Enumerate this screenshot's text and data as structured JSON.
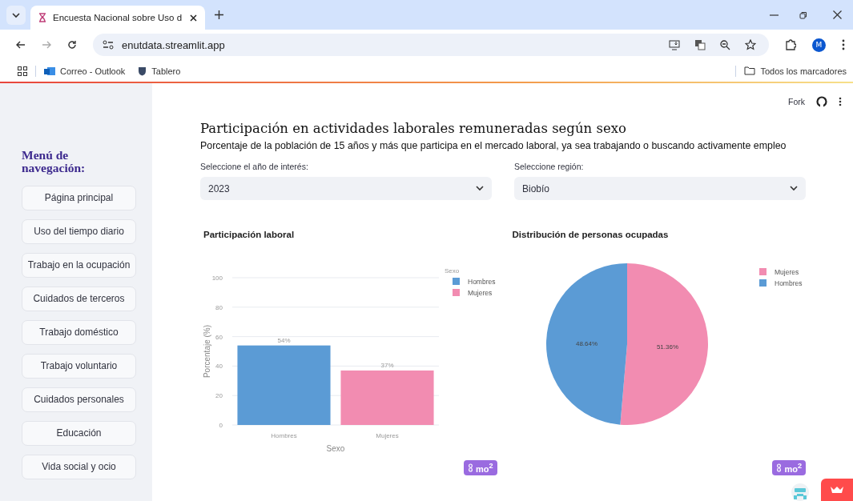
{
  "browser": {
    "tab_title": "Encuesta Nacional sobre Uso d",
    "url": "enutdata.streamlit.app",
    "avatar": "M",
    "bookmarks": [
      {
        "label": "Correo - Outlook",
        "kind": "mail"
      },
      {
        "label": "Tablero",
        "kind": "shield"
      }
    ],
    "all_bookmarks": "Todos los marcadores"
  },
  "toolbar": {
    "fork": "Fork"
  },
  "sidebar": {
    "title": "Menú de navegación:",
    "items": [
      {
        "label": "Página principal"
      },
      {
        "label": "Uso del tiempo diario"
      },
      {
        "label": "Trabajo en la ocupación"
      },
      {
        "label": "Cuidados de terceros"
      },
      {
        "label": "Trabajo doméstico"
      },
      {
        "label": "Trabajo voluntario"
      },
      {
        "label": "Cuidados personales"
      },
      {
        "label": "Educación"
      },
      {
        "label": "Vida social y ocio"
      }
    ]
  },
  "page": {
    "title": "Participación en actividades laborales remuneradas según sexo",
    "subtitle": "Porcentaje de la población de 15 años y más que participa en el mercado laboral, ya sea trabajando o buscando activamente empleo",
    "filters": [
      {
        "label": "Seleccione el año de interés:",
        "value": "2023"
      },
      {
        "label": "Seleccione región:",
        "value": "Biobío"
      }
    ],
    "charts": [
      {
        "title": "Participación laboral",
        "badge": "mo$^{2}$",
        "chart_data": {
          "type": "bar",
          "xlabel": "Sexo",
          "ylabel": "Porcentaje (%)",
          "legend": {
            "title": "Sexo"
          },
          "grid": true,
          "categories": [
            "Hombres",
            "Mujeres"
          ],
          "ylim": [
            0,
            100
          ],
          "yticks": [
            0,
            20,
            40,
            60,
            80,
            100
          ],
          "series": [
            {
              "name": "Hombres",
              "color": "#5b9bd5",
              "values": [
                54,
                null
              ]
            },
            {
              "name": "Mujeres",
              "color": "#f28cb1",
              "values": [
                null,
                37
              ]
            }
          ],
          "value_labels": [
            "54%",
            "37%"
          ]
        }
      },
      {
        "title": "Distribución de personas ocupadas",
        "badge": "mo$^{2}$",
        "chart_data": {
          "type": "pie",
          "legend": true,
          "categories": [
            "Mujeres",
            "Hombres"
          ],
          "values": [
            51.36,
            48.64
          ],
          "colors": [
            "#f28cb1",
            "#5b9bd5"
          ],
          "value_labels": [
            "51.36%",
            "48.64%"
          ]
        }
      }
    ]
  }
}
